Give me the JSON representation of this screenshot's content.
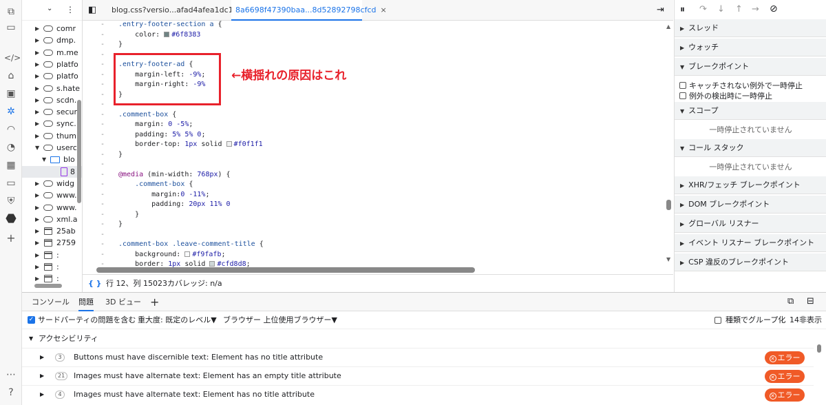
{
  "tree": {
    "items": [
      {
        "label": "comr",
        "kind": "cloud",
        "arrow": "▶"
      },
      {
        "label": "dmp.",
        "kind": "cloud",
        "arrow": "▶"
      },
      {
        "label": "m.me",
        "kind": "cloud",
        "arrow": "▶"
      },
      {
        "label": "platfo",
        "kind": "cloud",
        "arrow": "▶"
      },
      {
        "label": "platfo",
        "kind": "cloud",
        "arrow": "▶"
      },
      {
        "label": "s.hate",
        "kind": "cloud",
        "arrow": "▶"
      },
      {
        "label": "scdn.",
        "kind": "cloud",
        "arrow": "▶"
      },
      {
        "label": "secur",
        "kind": "cloud",
        "arrow": "▶"
      },
      {
        "label": "sync.",
        "kind": "cloud",
        "arrow": "▶"
      },
      {
        "label": "thum",
        "kind": "cloud",
        "arrow": "▶"
      },
      {
        "label": "userc",
        "kind": "cloud",
        "arrow": "▼"
      },
      {
        "label": "blo",
        "kind": "folder",
        "arrow": "▼"
      },
      {
        "label": "8",
        "kind": "file",
        "arrow": ""
      },
      {
        "label": "widg",
        "kind": "cloud",
        "arrow": "▶"
      },
      {
        "label": "www.",
        "kind": "cloud",
        "arrow": "▶"
      },
      {
        "label": "www.",
        "kind": "cloud",
        "arrow": "▶"
      },
      {
        "label": "xml.a",
        "kind": "cloud",
        "arrow": "▶"
      },
      {
        "label": "25ab",
        "kind": "frame",
        "arrow": "▶"
      },
      {
        "label": "2759",
        "kind": "frame",
        "arrow": "▶"
      },
      {
        "label": ":",
        "kind": "frame",
        "arrow": "▶"
      },
      {
        "label": ":",
        "kind": "frame",
        "arrow": "▶"
      },
      {
        "label": ":",
        "kind": "frame",
        "arrow": "▶"
      }
    ]
  },
  "tabs": {
    "tab1": "blog.css?versio...afad4afea1dc16",
    "tab2": "8a6698f47390baa...8d52892798cfcd",
    "close": "×"
  },
  "code": {
    "lines": [
      {
        "html": "<span class=\"sel-c\">.entry-footer-section a</span> {"
      },
      {
        "html": "    color: <span class=\"sw\" style=\"background:#6f8383\"></span><span class=\"num\">#6f8383</span>"
      },
      {
        "html": "}"
      },
      {
        "html": ""
      },
      {
        "html": "<span class=\"sel-c\">.entry-footer-ad</span> {"
      },
      {
        "html": "    margin-left: <span class=\"num\">-9%</span>;"
      },
      {
        "html": "    margin-right: <span class=\"num\">-9%</span>"
      },
      {
        "html": "}"
      },
      {
        "html": ""
      },
      {
        "html": "<span class=\"sel-c\">.comment-box</span> {"
      },
      {
        "html": "    margin: <span class=\"num\">0 -5%</span>;"
      },
      {
        "html": "    padding: <span class=\"num\">5% 5% 0</span>;"
      },
      {
        "html": "    border-top: <span class=\"num\">1px</span> solid <span class=\"sw\" style=\"background:#f0f1f1\"></span><span class=\"num\">#f0f1f1</span>"
      },
      {
        "html": "}"
      },
      {
        "html": ""
      },
      {
        "html": "<span class=\"kw\">@media</span> (min-width: <span class=\"num\">768px</span>) {"
      },
      {
        "html": "    <span class=\"sel-c\">.comment-box</span> {"
      },
      {
        "html": "        margin:<span class=\"num\">0 -11%</span>;"
      },
      {
        "html": "        padding: <span class=\"num\">20px 11% 0</span>"
      },
      {
        "html": "    }"
      },
      {
        "html": "}"
      },
      {
        "html": ""
      },
      {
        "html": "<span class=\"sel-c\">.comment-box .leave-comment-title</span> {"
      },
      {
        "html": "    background: <span class=\"sw\" style=\"background:#f9fafb\"></span><span class=\"num\">#f9fafb</span>;"
      },
      {
        "html": "    border: <span class=\"num\">1px</span> solid <span class=\"sw\" style=\"background:#cfd8d8\"></span><span class=\"num\">#cfd8d8</span>;"
      }
    ],
    "gutter": "-"
  },
  "annotation": "←横揺れの原因はこれ",
  "status": {
    "braces": "{ }",
    "position": "行 12、列 15023",
    "coverage": "カバレッジ: n/a"
  },
  "right": {
    "sections": [
      {
        "label": "スレッド",
        "arrow": "▶"
      },
      {
        "label": "ウォッチ",
        "arrow": "▶"
      },
      {
        "label": "ブレークポイント",
        "arrow": "▼"
      },
      {
        "label": "スコープ",
        "arrow": "▼"
      },
      {
        "label": "コール スタック",
        "arrow": "▼"
      },
      {
        "label": "XHR/フェッチ ブレークポイント",
        "arrow": "▶"
      },
      {
        "label": "DOM ブレークポイント",
        "arrow": "▶"
      },
      {
        "label": "グローバル リスナー",
        "arrow": "▶"
      },
      {
        "label": "イベント リスナー ブレークポイント",
        "arrow": "▶"
      },
      {
        "label": "CSP 違反のブレークポイント",
        "arrow": "▶"
      }
    ],
    "check1": "キャッチされない例外で一時停止",
    "check2": "例外の検出時に一時停止",
    "not_paused": "一時停止されていません"
  },
  "drawer": {
    "tabs": [
      "コンソール",
      "問題",
      "3D ビュー"
    ],
    "add": "+",
    "filter": {
      "third_party": "サードパーティの問題を含む",
      "severity": "重大度: 既定のレベル▼",
      "browser": "ブラウザー 上位使用ブラウザー▼",
      "group": "種類でグループ化",
      "hidden": "14非表示"
    },
    "category": "アクセシビリティ",
    "issues": [
      {
        "count": "3",
        "text": "Buttons must have discernible text: Element has no title attribute",
        "badge": "エラー"
      },
      {
        "count": "21",
        "text": "Images must have alternate text: Element has an empty title attribute",
        "badge": "エラー"
      },
      {
        "count": "4",
        "text": "Images must have alternate text: Element has no title attribute",
        "badge": "エラー"
      }
    ]
  },
  "colors": {
    "accent": "#1a73e8",
    "error": "#f05a27",
    "annotation": "#e8212b"
  }
}
